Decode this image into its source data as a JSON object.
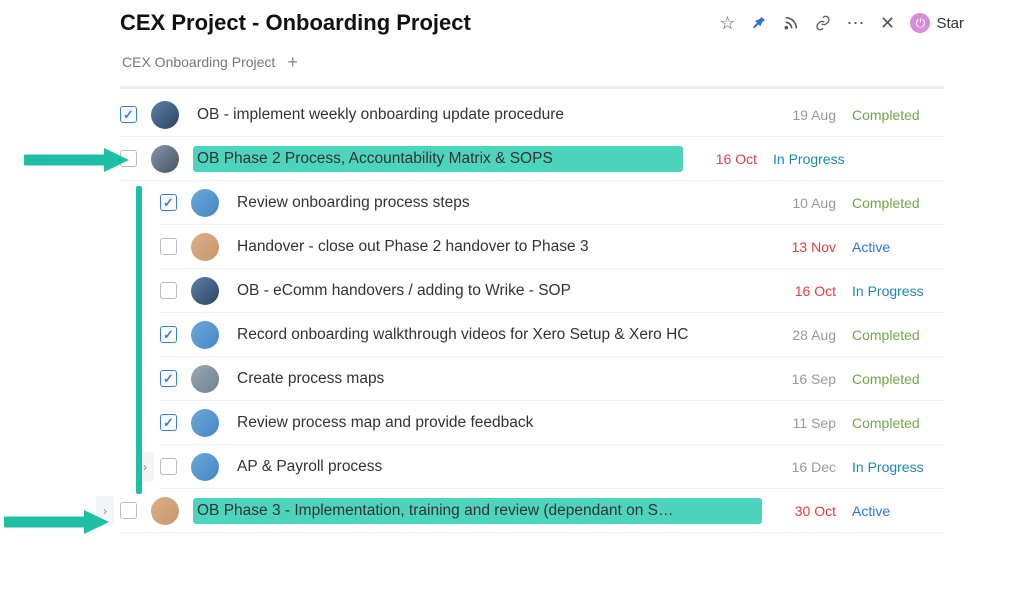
{
  "header": {
    "title": "CEX Project - Onboarding Project",
    "star_label": "Star"
  },
  "tabs": {
    "main": "CEX Onboarding Project"
  },
  "tasks": [
    {
      "title": "OB - implement weekly onboarding update procedure",
      "date": "19 Aug",
      "status": "Completed",
      "checked": true,
      "avatar": "a1",
      "indent": 0,
      "highlight": false,
      "overdue": false,
      "caret": false
    },
    {
      "title": "OB Phase 2 Process, Accountability Matrix & SOPS",
      "date": "16 Oct",
      "status": "In Progress",
      "checked": false,
      "avatar": "a2",
      "indent": 0,
      "highlight": true,
      "overdue": true,
      "caret": false
    },
    {
      "title": "Review onboarding process steps",
      "date": "10 Aug",
      "status": "Completed",
      "checked": true,
      "avatar": "a4",
      "indent": 1,
      "highlight": false,
      "overdue": false,
      "caret": false
    },
    {
      "title": "Handover - close out Phase 2 handover to Phase 3",
      "date": "13 Nov",
      "status": "Active",
      "checked": false,
      "avatar": "a3",
      "indent": 1,
      "highlight": false,
      "overdue": true,
      "caret": false
    },
    {
      "title": "OB - eComm handovers / adding to Wrike - SOP",
      "date": "16 Oct",
      "status": "In Progress",
      "checked": false,
      "avatar": "a1",
      "indent": 1,
      "highlight": false,
      "overdue": true,
      "caret": false
    },
    {
      "title": "Record onboarding walkthrough videos for Xero Setup & Xero HC",
      "date": "28 Aug",
      "status": "Completed",
      "checked": true,
      "avatar": "a4",
      "indent": 1,
      "highlight": false,
      "overdue": false,
      "caret": false
    },
    {
      "title": "Create process maps",
      "date": "16 Sep",
      "status": "Completed",
      "checked": true,
      "avatar": "a5",
      "indent": 1,
      "highlight": false,
      "overdue": false,
      "caret": false
    },
    {
      "title": "Review process map and provide feedback",
      "date": "11 Sep",
      "status": "Completed",
      "checked": true,
      "avatar": "a4",
      "indent": 1,
      "highlight": false,
      "overdue": false,
      "caret": false
    },
    {
      "title": "AP & Payroll process",
      "date": "16 Dec",
      "status": "In Progress",
      "checked": false,
      "avatar": "a4",
      "indent": 1,
      "highlight": false,
      "overdue": false,
      "caret": true
    },
    {
      "title": "OB Phase 3 - Implementation, training and review (dependant on S…",
      "date": "30 Oct",
      "status": "Active",
      "checked": false,
      "avatar": "a3",
      "indent": 0,
      "highlight": true,
      "overdue": true,
      "caret": true
    }
  ],
  "status_classes": {
    "Completed": "status-completed",
    "In Progress": "status-inprogress",
    "Active": "status-active"
  }
}
